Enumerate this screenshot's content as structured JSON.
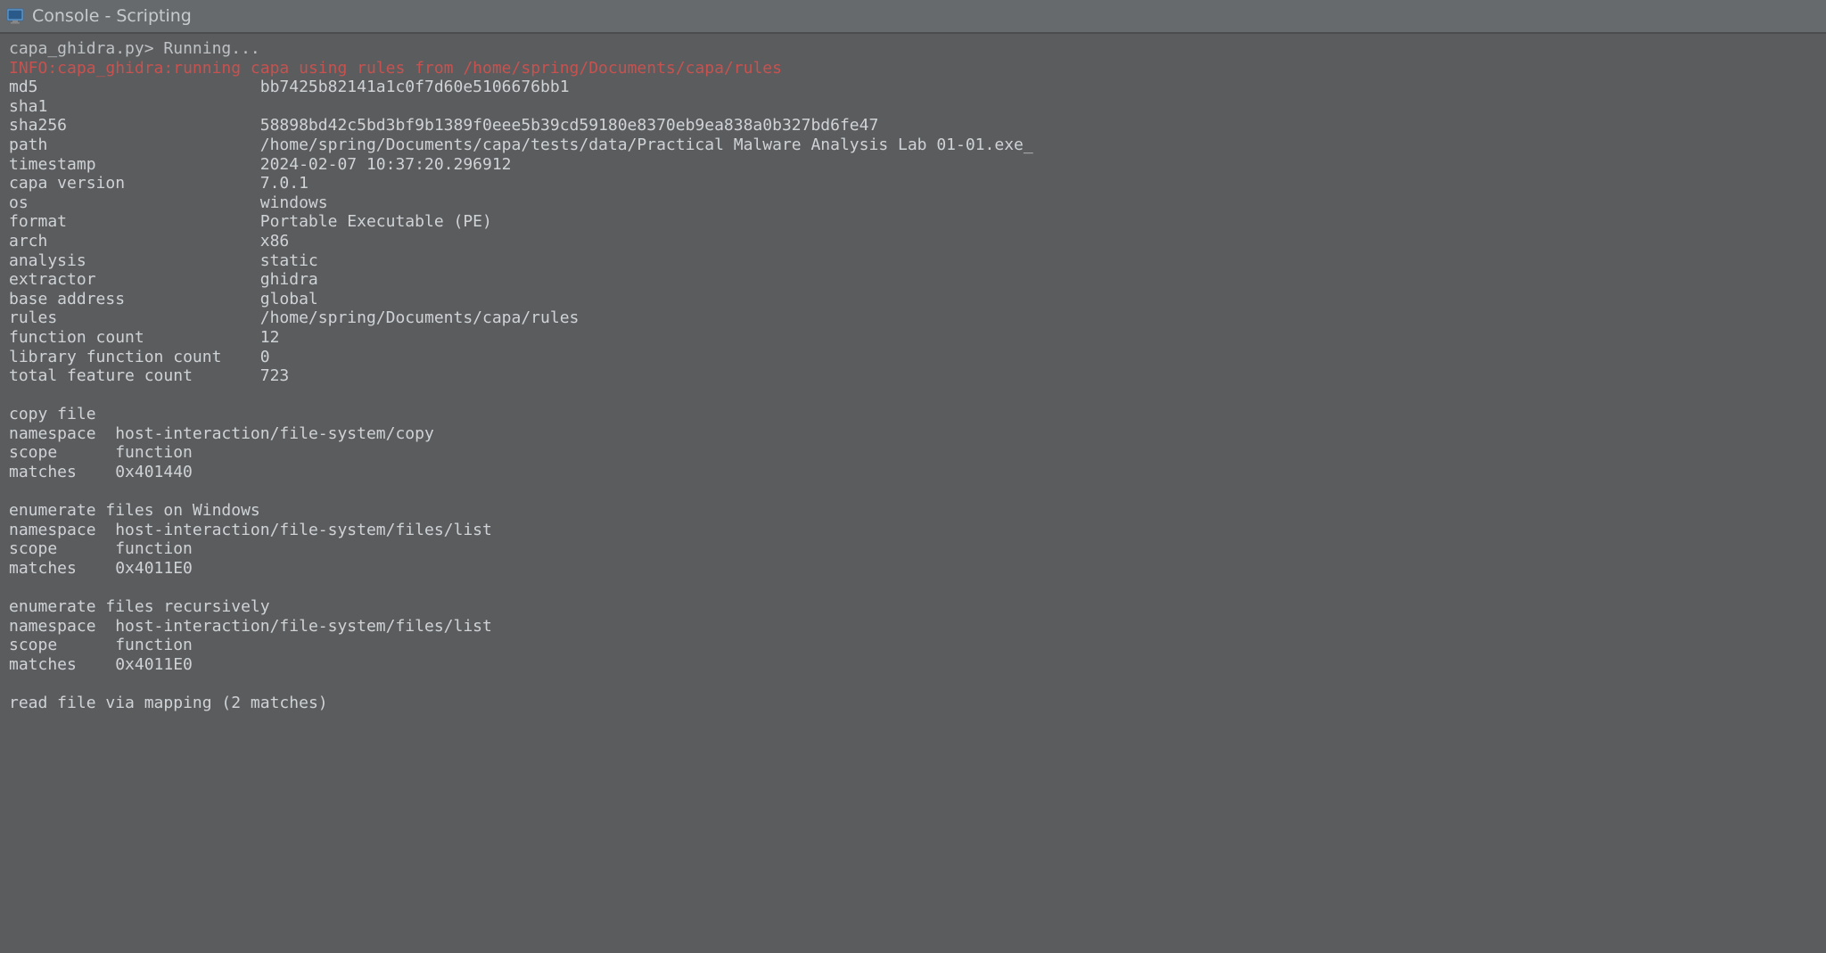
{
  "title": "Console - Scripting",
  "prompt": "capa_ghidra.py> Running...",
  "info_line": "INFO:capa_ghidra:running capa using rules from /home/spring/Documents/capa/rules",
  "meta": [
    {
      "k": "md5",
      "v": "bb7425b82141a1c0f7d60e5106676bb1"
    },
    {
      "k": "sha1",
      "v": ""
    },
    {
      "k": "sha256",
      "v": "58898bd42c5bd3bf9b1389f0eee5b39cd59180e8370eb9ea838a0b327bd6fe47"
    },
    {
      "k": "path",
      "v": "/home/spring/Documents/capa/tests/data/Practical Malware Analysis Lab 01-01.exe_"
    },
    {
      "k": "timestamp",
      "v": "2024-02-07 10:37:20.296912"
    },
    {
      "k": "capa version",
      "v": "7.0.1"
    },
    {
      "k": "os",
      "v": "windows"
    },
    {
      "k": "format",
      "v": "Portable Executable (PE)"
    },
    {
      "k": "arch",
      "v": "x86"
    },
    {
      "k": "analysis",
      "v": "static"
    },
    {
      "k": "extractor",
      "v": "ghidra"
    },
    {
      "k": "base address",
      "v": "global"
    },
    {
      "k": "rules",
      "v": "/home/spring/Documents/capa/rules"
    },
    {
      "k": "function count",
      "v": "12"
    },
    {
      "k": "library function count",
      "v": "0"
    },
    {
      "k": "total feature count",
      "v": "723"
    }
  ],
  "rules": [
    {
      "title": "copy file",
      "fields": [
        {
          "k": "namespace",
          "v": "host-interaction/file-system/copy"
        },
        {
          "k": "scope",
          "v": "function"
        },
        {
          "k": "matches",
          "v": "0x401440"
        }
      ]
    },
    {
      "title": "enumerate files on Windows",
      "fields": [
        {
          "k": "namespace",
          "v": "host-interaction/file-system/files/list"
        },
        {
          "k": "scope",
          "v": "function"
        },
        {
          "k": "matches",
          "v": "0x4011E0"
        }
      ]
    },
    {
      "title": "enumerate files recursively",
      "fields": [
        {
          "k": "namespace",
          "v": "host-interaction/file-system/files/list"
        },
        {
          "k": "scope",
          "v": "function"
        },
        {
          "k": "matches",
          "v": "0x4011E0"
        }
      ]
    }
  ],
  "trailing": "read file via mapping (2 matches)"
}
